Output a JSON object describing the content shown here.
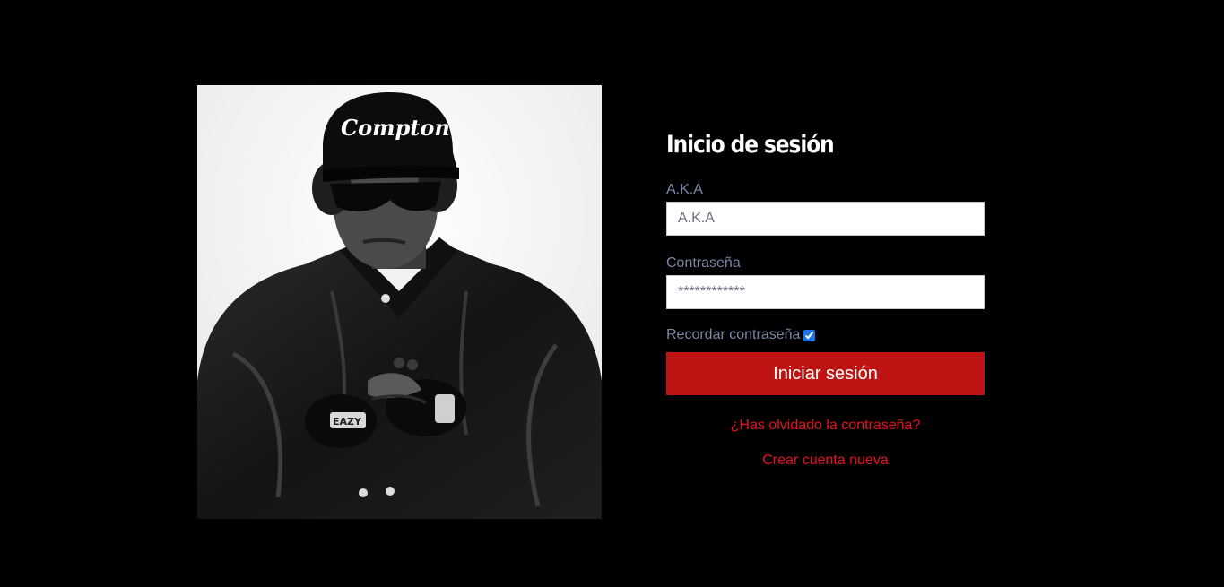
{
  "login": {
    "title": "Inicio de sesión",
    "aka_label": "A.K.A",
    "aka_placeholder": "A.K.A",
    "aka_value": "",
    "password_label": "Contraseña",
    "password_placeholder": "************",
    "password_value": "",
    "remember_label": "Recordar contraseña",
    "remember_checked": true,
    "submit_label": "Iniciar sesión",
    "forgot_link": "¿Has olvidado la contraseña?",
    "create_link": "Crear cuenta nueva"
  },
  "photo": {
    "cap_text": "Compton",
    "buckle_text": "EAZY"
  },
  "colors": {
    "background": "#000000",
    "button": "#c01414",
    "link": "#e4141c",
    "label": "#7b86a7"
  }
}
